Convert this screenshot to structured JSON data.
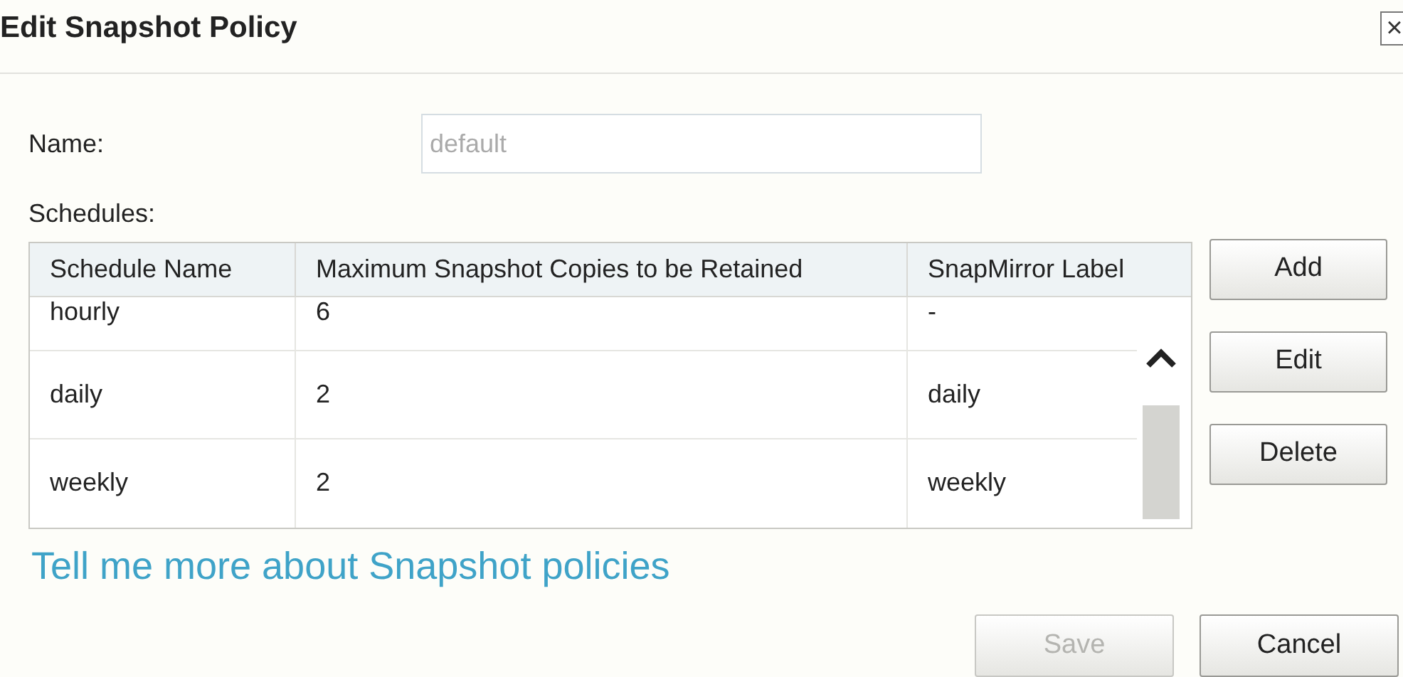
{
  "window": {
    "title": "Edit Snapshot Policy",
    "close": "×"
  },
  "name_field": {
    "label": "Name:",
    "value": "default",
    "disabled": true
  },
  "schedules_label": "Schedules:",
  "table": {
    "columns": [
      "Schedule Name",
      "Maximum Snapshot Copies to be Retained",
      "SnapMirror Label"
    ],
    "rows": [
      {
        "cells": [
          "hourly",
          "6",
          "-"
        ]
      },
      {
        "cells": [
          "daily",
          "2",
          "daily"
        ]
      },
      {
        "cells": [
          "weekly",
          "2",
          "weekly"
        ]
      }
    ]
  },
  "side_buttons": [
    {
      "label": "Add",
      "disabled": false
    },
    {
      "label": "Edit",
      "disabled": false
    },
    {
      "label": "Delete",
      "disabled": false
    }
  ],
  "link": "Tell me more about Snapshot policies",
  "footer_buttons": [
    {
      "label": "Save",
      "disabled": true
    },
    {
      "label": "Cancel",
      "disabled": false
    }
  ]
}
